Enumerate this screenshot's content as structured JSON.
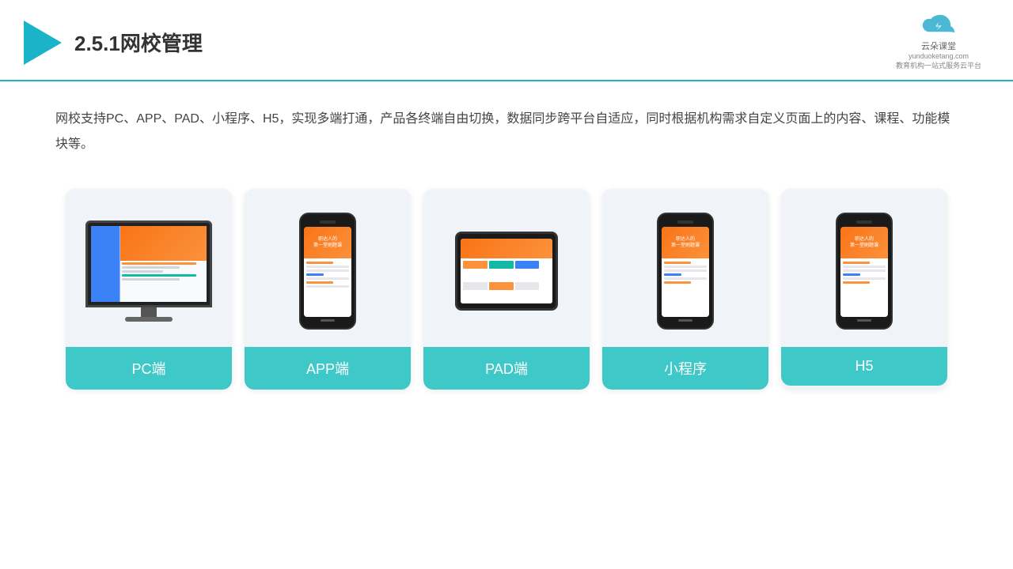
{
  "header": {
    "title": "2.5.1网校管理",
    "brand": {
      "name": "云朵课堂",
      "domain": "yunduoketang.com",
      "slogan": "教育机构一站\n式服务云平台"
    }
  },
  "description": "网校支持PC、APP、PAD、小程序、H5，实现多端打通，产品各终端自由切换，数据同步跨平台自适应，同时根据机构需求自定义页面上的内容、课程、功能模块等。",
  "cards": [
    {
      "id": "pc",
      "label": "PC端"
    },
    {
      "id": "app",
      "label": "APP端"
    },
    {
      "id": "pad",
      "label": "PAD端"
    },
    {
      "id": "miniapp",
      "label": "小程序"
    },
    {
      "id": "h5",
      "label": "H5"
    }
  ]
}
